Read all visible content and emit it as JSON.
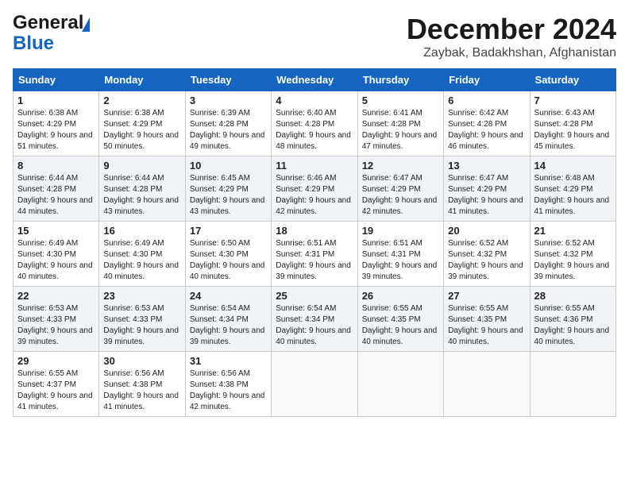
{
  "header": {
    "logo_general": "General",
    "logo_blue": "Blue",
    "month": "December 2024",
    "location": "Zaybak, Badakhshan, Afghanistan"
  },
  "weekdays": [
    "Sunday",
    "Monday",
    "Tuesday",
    "Wednesday",
    "Thursday",
    "Friday",
    "Saturday"
  ],
  "weeks": [
    [
      {
        "day": "1",
        "sunrise": "6:38 AM",
        "sunset": "4:29 PM",
        "daylight": "9 hours and 51 minutes."
      },
      {
        "day": "2",
        "sunrise": "6:38 AM",
        "sunset": "4:29 PM",
        "daylight": "9 hours and 50 minutes."
      },
      {
        "day": "3",
        "sunrise": "6:39 AM",
        "sunset": "4:28 PM",
        "daylight": "9 hours and 49 minutes."
      },
      {
        "day": "4",
        "sunrise": "6:40 AM",
        "sunset": "4:28 PM",
        "daylight": "9 hours and 48 minutes."
      },
      {
        "day": "5",
        "sunrise": "6:41 AM",
        "sunset": "4:28 PM",
        "daylight": "9 hours and 47 minutes."
      },
      {
        "day": "6",
        "sunrise": "6:42 AM",
        "sunset": "4:28 PM",
        "daylight": "9 hours and 46 minutes."
      },
      {
        "day": "7",
        "sunrise": "6:43 AM",
        "sunset": "4:28 PM",
        "daylight": "9 hours and 45 minutes."
      }
    ],
    [
      {
        "day": "8",
        "sunrise": "6:44 AM",
        "sunset": "4:28 PM",
        "daylight": "9 hours and 44 minutes."
      },
      {
        "day": "9",
        "sunrise": "6:44 AM",
        "sunset": "4:28 PM",
        "daylight": "9 hours and 43 minutes."
      },
      {
        "day": "10",
        "sunrise": "6:45 AM",
        "sunset": "4:29 PM",
        "daylight": "9 hours and 43 minutes."
      },
      {
        "day": "11",
        "sunrise": "6:46 AM",
        "sunset": "4:29 PM",
        "daylight": "9 hours and 42 minutes."
      },
      {
        "day": "12",
        "sunrise": "6:47 AM",
        "sunset": "4:29 PM",
        "daylight": "9 hours and 42 minutes."
      },
      {
        "day": "13",
        "sunrise": "6:47 AM",
        "sunset": "4:29 PM",
        "daylight": "9 hours and 41 minutes."
      },
      {
        "day": "14",
        "sunrise": "6:48 AM",
        "sunset": "4:29 PM",
        "daylight": "9 hours and 41 minutes."
      }
    ],
    [
      {
        "day": "15",
        "sunrise": "6:49 AM",
        "sunset": "4:30 PM",
        "daylight": "9 hours and 40 minutes."
      },
      {
        "day": "16",
        "sunrise": "6:49 AM",
        "sunset": "4:30 PM",
        "daylight": "9 hours and 40 minutes."
      },
      {
        "day": "17",
        "sunrise": "6:50 AM",
        "sunset": "4:30 PM",
        "daylight": "9 hours and 40 minutes."
      },
      {
        "day": "18",
        "sunrise": "6:51 AM",
        "sunset": "4:31 PM",
        "daylight": "9 hours and 39 minutes."
      },
      {
        "day": "19",
        "sunrise": "6:51 AM",
        "sunset": "4:31 PM",
        "daylight": "9 hours and 39 minutes."
      },
      {
        "day": "20",
        "sunrise": "6:52 AM",
        "sunset": "4:32 PM",
        "daylight": "9 hours and 39 minutes."
      },
      {
        "day": "21",
        "sunrise": "6:52 AM",
        "sunset": "4:32 PM",
        "daylight": "9 hours and 39 minutes."
      }
    ],
    [
      {
        "day": "22",
        "sunrise": "6:53 AM",
        "sunset": "4:33 PM",
        "daylight": "9 hours and 39 minutes."
      },
      {
        "day": "23",
        "sunrise": "6:53 AM",
        "sunset": "4:33 PM",
        "daylight": "9 hours and 39 minutes."
      },
      {
        "day": "24",
        "sunrise": "6:54 AM",
        "sunset": "4:34 PM",
        "daylight": "9 hours and 39 minutes."
      },
      {
        "day": "25",
        "sunrise": "6:54 AM",
        "sunset": "4:34 PM",
        "daylight": "9 hours and 40 minutes."
      },
      {
        "day": "26",
        "sunrise": "6:55 AM",
        "sunset": "4:35 PM",
        "daylight": "9 hours and 40 minutes."
      },
      {
        "day": "27",
        "sunrise": "6:55 AM",
        "sunset": "4:35 PM",
        "daylight": "9 hours and 40 minutes."
      },
      {
        "day": "28",
        "sunrise": "6:55 AM",
        "sunset": "4:36 PM",
        "daylight": "9 hours and 40 minutes."
      }
    ],
    [
      {
        "day": "29",
        "sunrise": "6:55 AM",
        "sunset": "4:37 PM",
        "daylight": "9 hours and 41 minutes."
      },
      {
        "day": "30",
        "sunrise": "6:56 AM",
        "sunset": "4:38 PM",
        "daylight": "9 hours and 41 minutes."
      },
      {
        "day": "31",
        "sunrise": "6:56 AM",
        "sunset": "4:38 PM",
        "daylight": "9 hours and 42 minutes."
      },
      null,
      null,
      null,
      null
    ]
  ],
  "labels": {
    "sunrise": "Sunrise: ",
    "sunset": "Sunset: ",
    "daylight": "Daylight: "
  }
}
